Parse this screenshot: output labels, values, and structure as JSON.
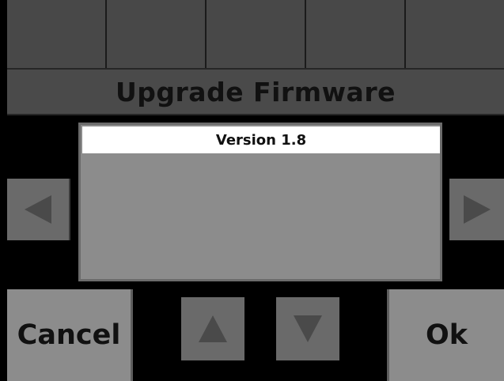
{
  "tabs": [
    "",
    "",
    "",
    "",
    ""
  ],
  "title": "Upgrade Firmware",
  "panel": {
    "header": "Version 1.8",
    "body": ""
  },
  "nav": {
    "left_icon": "triangle-left-icon",
    "right_icon": "triangle-right-icon",
    "up_icon": "triangle-up-icon",
    "down_icon": "triangle-down-icon"
  },
  "buttons": {
    "cancel": "Cancel",
    "ok": "Ok"
  },
  "colors": {
    "background": "#000000",
    "tile": "#484848",
    "panel": "#8c8c8c",
    "panel_header": "#ffffff",
    "arrow_button": "#6a6a6a",
    "arrow_glyph": "#4a4a4a",
    "text": "#111111"
  }
}
